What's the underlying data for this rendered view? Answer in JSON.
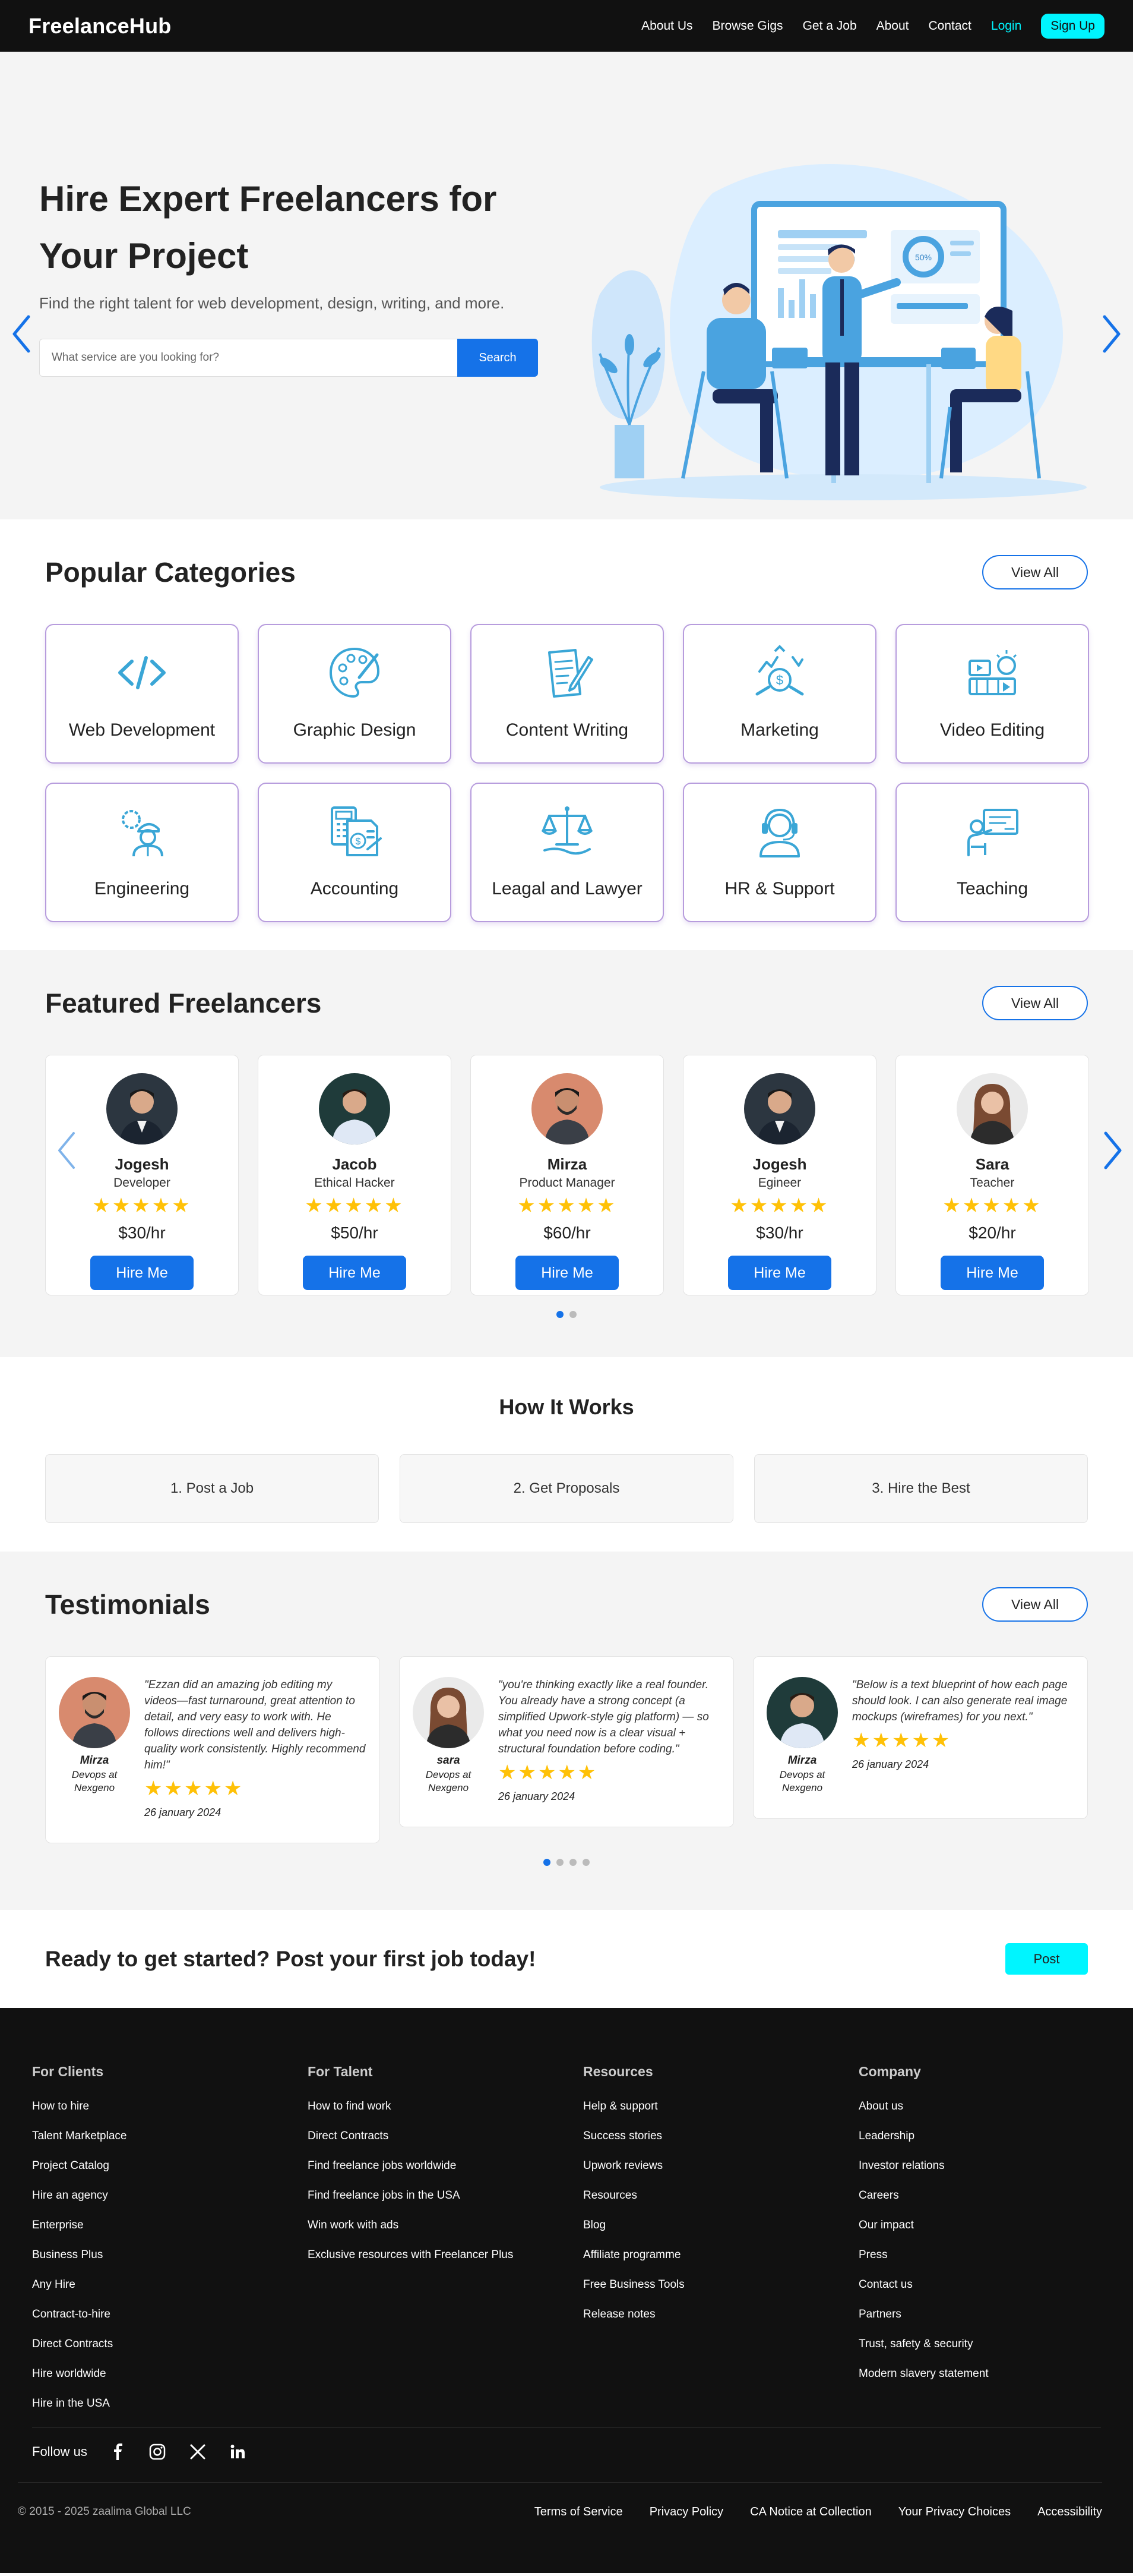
{
  "nav": {
    "brand": "FreelanceHub",
    "links": [
      "About Us",
      "Browse Gigs",
      "Get a Job",
      "About",
      "Contact"
    ],
    "login": "Login",
    "signup": "Sign Up"
  },
  "hero": {
    "title_line1": "Hire Expert Freelancers for",
    "title_line2": "Your Project",
    "subtitle": "Find the right talent for web development, design, writing, and more.",
    "search_placeholder": "What service are you looking for?",
    "search_button": "Search",
    "illustration_stat": "50%"
  },
  "categories": {
    "title": "Popular Categories",
    "view_all": "View All",
    "items": [
      {
        "label": "Web Development",
        "icon": "code-icon"
      },
      {
        "label": "Graphic Design",
        "icon": "palette-icon"
      },
      {
        "label": "Content Writing",
        "icon": "writing-icon"
      },
      {
        "label": "Marketing",
        "icon": "marketing-icon"
      },
      {
        "label": "Video Editing",
        "icon": "video-icon"
      },
      {
        "label": "Engineering",
        "icon": "engineer-icon"
      },
      {
        "label": "Accounting",
        "icon": "calculator-icon"
      },
      {
        "label": "Leagal and Lawyer",
        "icon": "scales-icon"
      },
      {
        "label": "HR & Support",
        "icon": "headset-icon"
      },
      {
        "label": "Teaching",
        "icon": "teacher-icon"
      }
    ]
  },
  "featured": {
    "title": "Featured Freelancers",
    "view_all": "View All",
    "stars": "★★★★★",
    "hire": "Hire Me",
    "items": [
      {
        "name": "Jogesh",
        "role": "Developer",
        "rate": "$30/hr"
      },
      {
        "name": "Jacob",
        "role": "Ethical Hacker",
        "rate": "$50/hr"
      },
      {
        "name": "Mirza",
        "role": "Product Manager",
        "rate": "$60/hr"
      },
      {
        "name": "Jogesh",
        "role": "Egineer",
        "rate": "$30/hr"
      },
      {
        "name": "Sara",
        "role": "Teacher",
        "rate": "$20/hr"
      }
    ]
  },
  "how": {
    "title": "How It Works",
    "steps": [
      "1. Post a Job",
      "2. Get Proposals",
      "3. Hire the Best"
    ]
  },
  "testimonials": {
    "title": "Testimonials",
    "view_all": "View All",
    "stars": "★★★★★",
    "items": [
      {
        "name": "Mirza",
        "role": "Devops at Nexgeno",
        "quote": "\"Ezzan did an amazing job editing my videos—fast turnaround, great attention to detail, and very easy to work with. He follows directions well and delivers high-quality work consistently. Highly recommend him!\"",
        "date": "26 january 2024"
      },
      {
        "name": "sara",
        "role": "Devops at Nexgeno",
        "quote": "\"you're thinking exactly like a real founder. You already have a strong concept (a simplified Upwork-style gig platform) — so what you need now is a clear visual + structural foundation before coding.\"",
        "date": "26 january 2024"
      },
      {
        "name": "Mirza",
        "role": "Devops at Nexgeno",
        "quote": "\"Below is a text blueprint of how each page should look. I can also generate real image mockups (wireframes) for you next.\"",
        "date": "26 january 2024"
      }
    ]
  },
  "cta": {
    "text": "Ready to get started? Post your first job today!",
    "button": "Post"
  },
  "footer": {
    "columns": [
      {
        "title": "For Clients",
        "links": [
          "How to hire",
          "Talent Marketplace",
          "Project Catalog",
          "Hire an agency",
          "Enterprise",
          "Business Plus",
          "Any Hire",
          "Contract-to-hire",
          "Direct Contracts",
          "Hire worldwide",
          "Hire in the USA"
        ]
      },
      {
        "title": "For Talent",
        "links": [
          "How to find work",
          "Direct Contracts",
          "Find freelance jobs worldwide",
          "Find freelance jobs in the USA",
          "Win work with ads",
          "Exclusive resources with Freelancer Plus"
        ]
      },
      {
        "title": "Resources",
        "links": [
          "Help & support",
          "Success stories",
          "Upwork reviews",
          "Resources",
          "Blog",
          "Affiliate programme",
          "Free Business Tools",
          "Release notes"
        ]
      },
      {
        "title": "Company",
        "links": [
          "About us",
          "Leadership",
          "Investor relations",
          "Careers",
          "Our impact",
          "Press",
          "Contact us",
          "Partners",
          "Trust, safety & security",
          "Modern slavery statement"
        ]
      }
    ],
    "follow_label": "Follow us",
    "social": [
      "facebook-icon",
      "instagram-icon",
      "x-icon",
      "linkedin-icon"
    ],
    "copyright": "© 2015 - 2025 zaalima Global LLC",
    "legal": [
      "Terms of Service",
      "Privacy Policy",
      "CA Notice at Collection",
      "Your Privacy Choices",
      "Accessibility"
    ]
  },
  "colors": {
    "accent": "#1572e8",
    "cyan": "#00f5ff",
    "dark": "#111111",
    "card_border": "#b79cdd",
    "star": "#ffc107",
    "icon": "#3aa6d6"
  }
}
